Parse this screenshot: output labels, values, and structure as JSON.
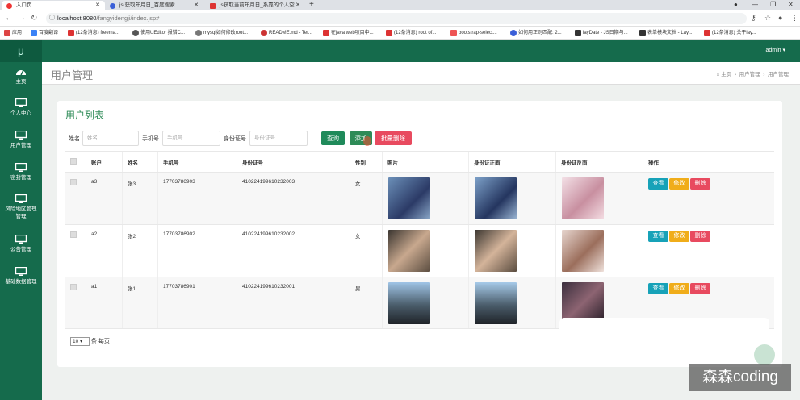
{
  "browser": {
    "tabs": [
      {
        "title": "入口页",
        "active": true
      },
      {
        "title": "js 获取年月日_百度搜索",
        "active": false
      },
      {
        "title": "js获取当前年月日_系靠的个人空",
        "active": false
      }
    ],
    "new_tab": "+",
    "url_host": "localhost:8080",
    "url_path": "/fangyidengji/index.jsp#",
    "bookmarks": [
      "应用",
      "百度翻译",
      "(12条消息) freema...",
      "使用UEditor 报错C...",
      "mysql如何修改root...",
      "README.md - Ter...",
      "在java web项目中...",
      "(12条消息) root of...",
      "bootstrap-select...",
      "如何用正则匹配: 2...",
      "layDate - JS日期与...",
      "表单模块文档 - Lay...",
      "(12条消息) 关于lay..."
    ]
  },
  "app": {
    "logo": "μ",
    "user": "admin ▾",
    "sidebar": [
      {
        "label": "主页",
        "icon": "dashboard-icon"
      },
      {
        "label": "个人中心",
        "icon": "monitor-icon"
      },
      {
        "label": "用户管理",
        "icon": "monitor-icon"
      },
      {
        "label": "密封管理",
        "icon": "monitor-icon"
      },
      {
        "label": "风险地区管理",
        "label2": "管理",
        "icon": "monitor-icon"
      },
      {
        "label": "公告管理",
        "icon": "monitor-icon"
      },
      {
        "label": "基础数据管理",
        "icon": "monitor-icon"
      }
    ]
  },
  "page": {
    "title": "用户管理",
    "breadcrumb": [
      "主页",
      "用户管理",
      "用户管理"
    ],
    "card_title": "用户列表"
  },
  "search": {
    "name_label": "姓名",
    "name_placeholder": "姓名",
    "phone_label": "手机号",
    "phone_placeholder": "手机号",
    "id_label": "身份证号",
    "id_placeholder": "身份证号",
    "query_btn": "查询",
    "add_btn": "添加",
    "batch_delete_btn": "批量删除"
  },
  "table": {
    "headers": [
      "账户",
      "姓名",
      "手机号",
      "身份证号",
      "性别",
      "照片",
      "身份证正面",
      "身份证反面",
      "操作"
    ],
    "rows": [
      {
        "account": "a3",
        "name": "张3",
        "phone": "17703786903",
        "id": "410224199610232003",
        "gender": "女"
      },
      {
        "account": "a2",
        "name": "张2",
        "phone": "17703786902",
        "id": "410224199610232002",
        "gender": "女"
      },
      {
        "account": "a1",
        "name": "张1",
        "phone": "17703786901",
        "id": "410224199610232001",
        "gender": "男"
      }
    ],
    "actions": [
      "查看",
      "修改",
      "删除"
    ]
  },
  "pager": {
    "page_size": "10",
    "suffix": "条 每页"
  },
  "watermark": "森森coding",
  "colors": {
    "primary": "#156b4c",
    "query": "#1f8a5a",
    "add": "#2e8b57",
    "delete": "#e84a5f",
    "view": "#17a2b8",
    "edit": "#f0ad1a"
  }
}
